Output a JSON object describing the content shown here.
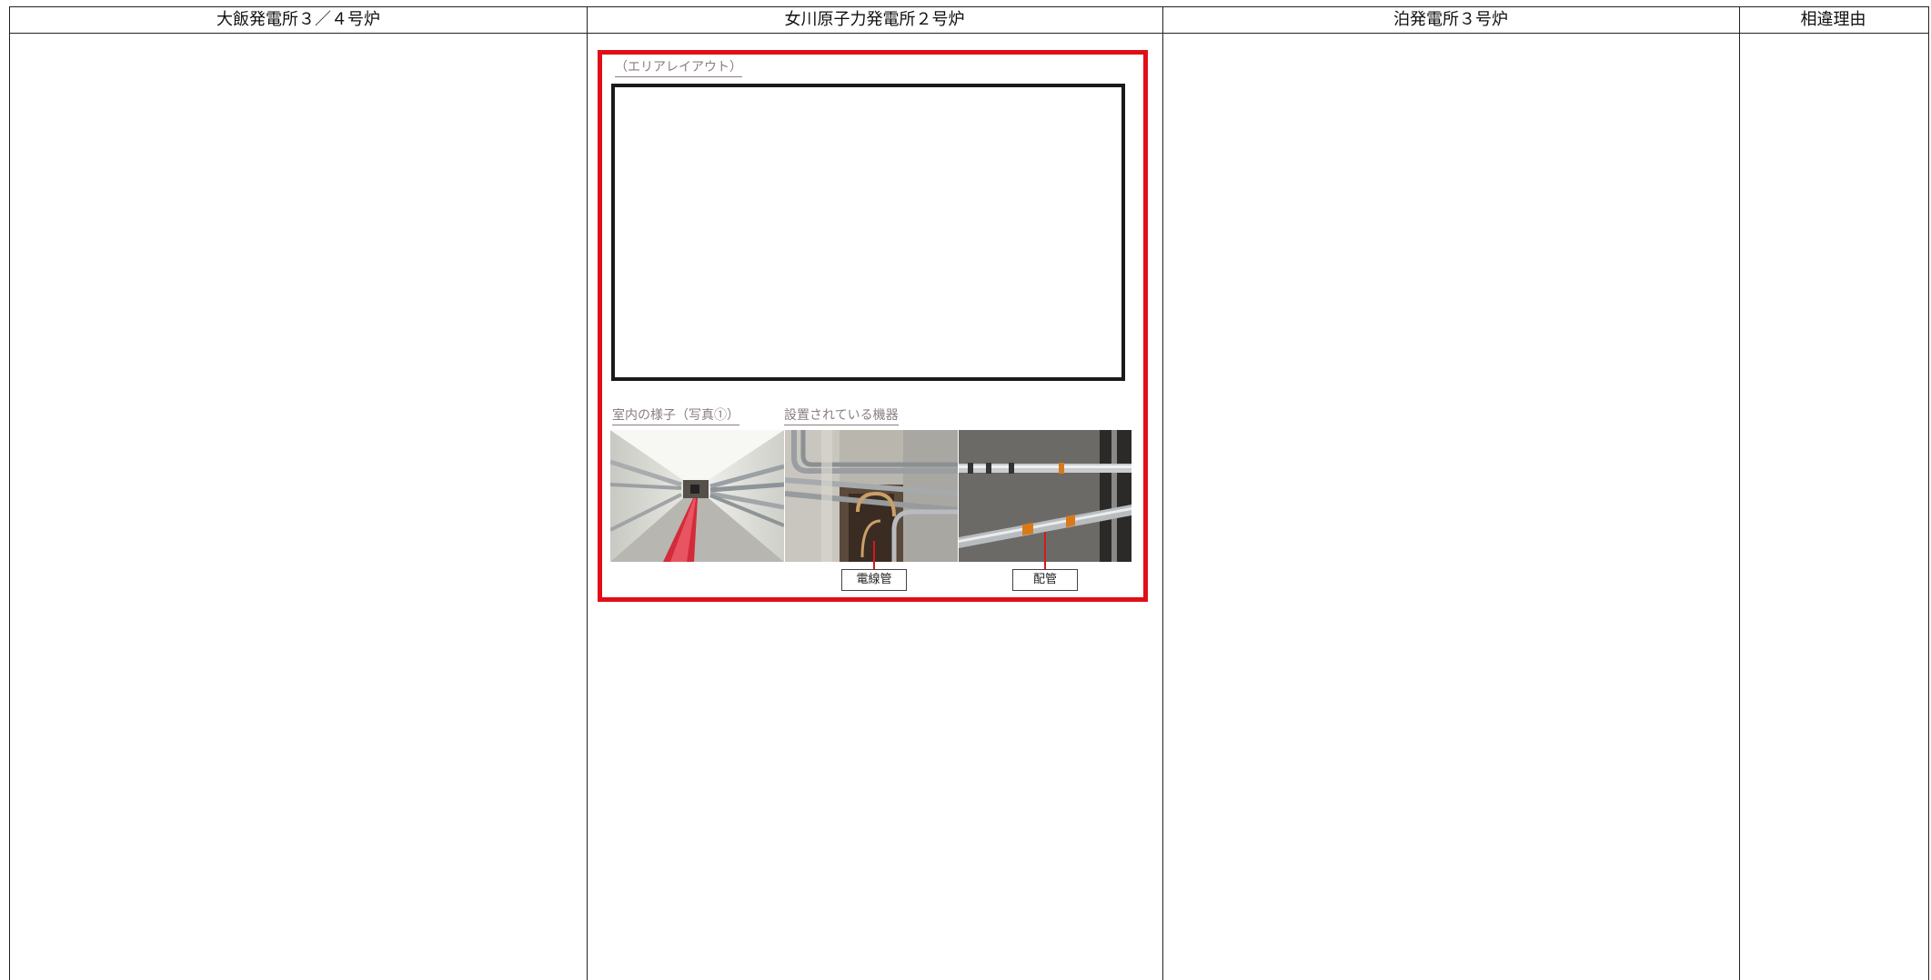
{
  "columns": [
    {
      "title": "大飯発電所３／４号炉"
    },
    {
      "title": "女川原子力発電所２号炉"
    },
    {
      "title": "泊発電所３号炉"
    },
    {
      "title": "相違理由"
    }
  ],
  "figure": {
    "area_layout_caption": "（エリアレイアウト）",
    "room_photo_caption": "室内の様子（写真①）",
    "equipment_caption": "設置されている機器",
    "label_conduit": "電線管",
    "label_piping": "配管"
  },
  "colors": {
    "frame_red": "#e10e18",
    "header_text_dark": "#111111",
    "caption_gray": "#8a7e82"
  }
}
